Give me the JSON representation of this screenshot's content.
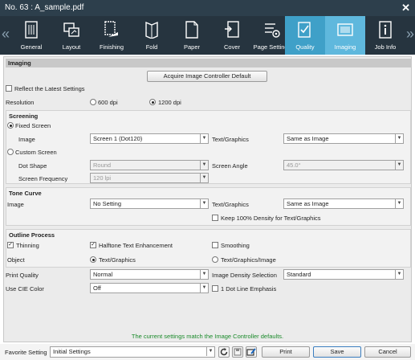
{
  "window": {
    "title": "No. 63 : A_sample.pdf",
    "close_glyph": "✕"
  },
  "toolbar": {
    "left_arrow": "«",
    "right_arrow": "»",
    "tabs": [
      {
        "label": "General",
        "icon": "general-icon"
      },
      {
        "label": "Layout",
        "icon": "layout-icon"
      },
      {
        "label": "Finishing",
        "icon": "finishing-icon"
      },
      {
        "label": "Fold",
        "icon": "fold-icon"
      },
      {
        "label": "Paper",
        "icon": "paper-icon"
      },
      {
        "label": "Cover",
        "icon": "cover-icon"
      },
      {
        "label": "Page Settings",
        "icon": "page-settings-icon"
      },
      {
        "label": "Quality",
        "icon": "quality-icon"
      },
      {
        "label": "Imaging",
        "icon": "imaging-icon"
      },
      {
        "label": "Job Info",
        "icon": "job-info-icon"
      }
    ],
    "active_tab": "Imaging"
  },
  "imaging": {
    "header": "Imaging",
    "acquire_button": "Acquire Image Controller Default",
    "reflect_latest": "Reflect the Latest Settings",
    "resolution_label": "Resolution",
    "res_600": "600 dpi",
    "res_1200": "1200 dpi",
    "resolution_selected": "1200 dpi"
  },
  "screening": {
    "title": "Screening",
    "fixed_screen": "Fixed Screen",
    "image_label": "Image",
    "image_value": "Screen 1 (Dot120)",
    "text_graphics_label": "Text/Graphics",
    "text_graphics_value": "Same as Image",
    "custom_screen": "Custom Screen",
    "dot_shape_label": "Dot Shape",
    "dot_shape_value": "Round",
    "screen_angle_label": "Screen Angle",
    "screen_angle_value": "45.0°",
    "screen_freq_label": "Screen Frequency",
    "screen_freq_value": "120 lpi"
  },
  "tone_curve": {
    "title": "Tone Curve",
    "image_label": "Image",
    "image_value": "No Setting",
    "text_graphics_label": "Text/Graphics",
    "text_graphics_value": "Same as Image",
    "keep_density": "Keep 100% Density for Text/Graphics"
  },
  "outline": {
    "title": "Outline Process",
    "thinning": "Thinning",
    "halftone": "Halftone Text Enhancement",
    "smoothing": "Smoothing",
    "object_label": "Object",
    "obj_text_graphics": "Text/Graphics",
    "obj_text_graphics_image": "Text/Graphics/Image"
  },
  "quality": {
    "print_quality_label": "Print Quality",
    "print_quality_value": "Normal",
    "density_sel_label": "Image Density Selection",
    "density_sel_value": "Standard",
    "cie_label": "Use CIE Color",
    "cie_value": "Off",
    "dot_line": "1 Dot Line Emphasis"
  },
  "status_text": "The current settings match the Image Controller defaults.",
  "footer": {
    "favorite_label": "Favorite Setting",
    "favorite_value": "Initial Settings",
    "print": "Print",
    "save": "Save",
    "cancel": "Cancel"
  },
  "colors": {
    "titlebar": "#2d3f4c",
    "toolbar": "#26343f",
    "tab_active": "#3fa0c8",
    "tab_selected": "#5fb8dd",
    "status_ok": "#1a8a2a"
  }
}
